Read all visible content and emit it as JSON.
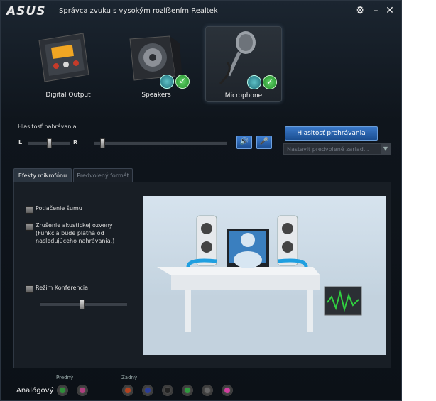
{
  "window": {
    "logo": "ASUS",
    "title": "Správca zvuku s vysokým rozlíšením Realtek"
  },
  "devices": [
    {
      "label": "Digital Output"
    },
    {
      "label": "Speakers"
    },
    {
      "label": "Microphone"
    }
  ],
  "recording": {
    "section_label": "Hlasitosť nahrávania",
    "left_label": "L",
    "right_label": "R",
    "balance": 0.5,
    "volume": 0.05
  },
  "playback_button": "Hlasitosť prehrávania",
  "default_device_dropdown": "Nastaviť predvolené zariad...",
  "tabs": [
    {
      "label": "Efekty mikrofónu",
      "active": true
    },
    {
      "label": "Predvolený formát",
      "active": false
    }
  ],
  "effects": {
    "noise_suppression": "Potlačenie šumu",
    "echo_cancellation_1": "Zrušenie akustickej ozveny",
    "echo_cancellation_2": "(Funkcia bude platná od",
    "echo_cancellation_3": "nasledujúceho nahrávania.)",
    "conference_mode": "Režim Konferencia",
    "conference_level": 0.48
  },
  "analog": {
    "label": "Analógový",
    "front_label": "Predný",
    "rear_label": "Zadný",
    "front_jacks": [
      "#2f8f3a",
      "#b0407f"
    ],
    "rear_jacks": [
      "#b3421f",
      "#2a3d9a",
      "#222222",
      "#2f9a3f",
      "#666666",
      "#d23fa0"
    ]
  },
  "colors": {
    "accent_blue": "#2f6fc0",
    "status_green": "#2fa83a"
  }
}
